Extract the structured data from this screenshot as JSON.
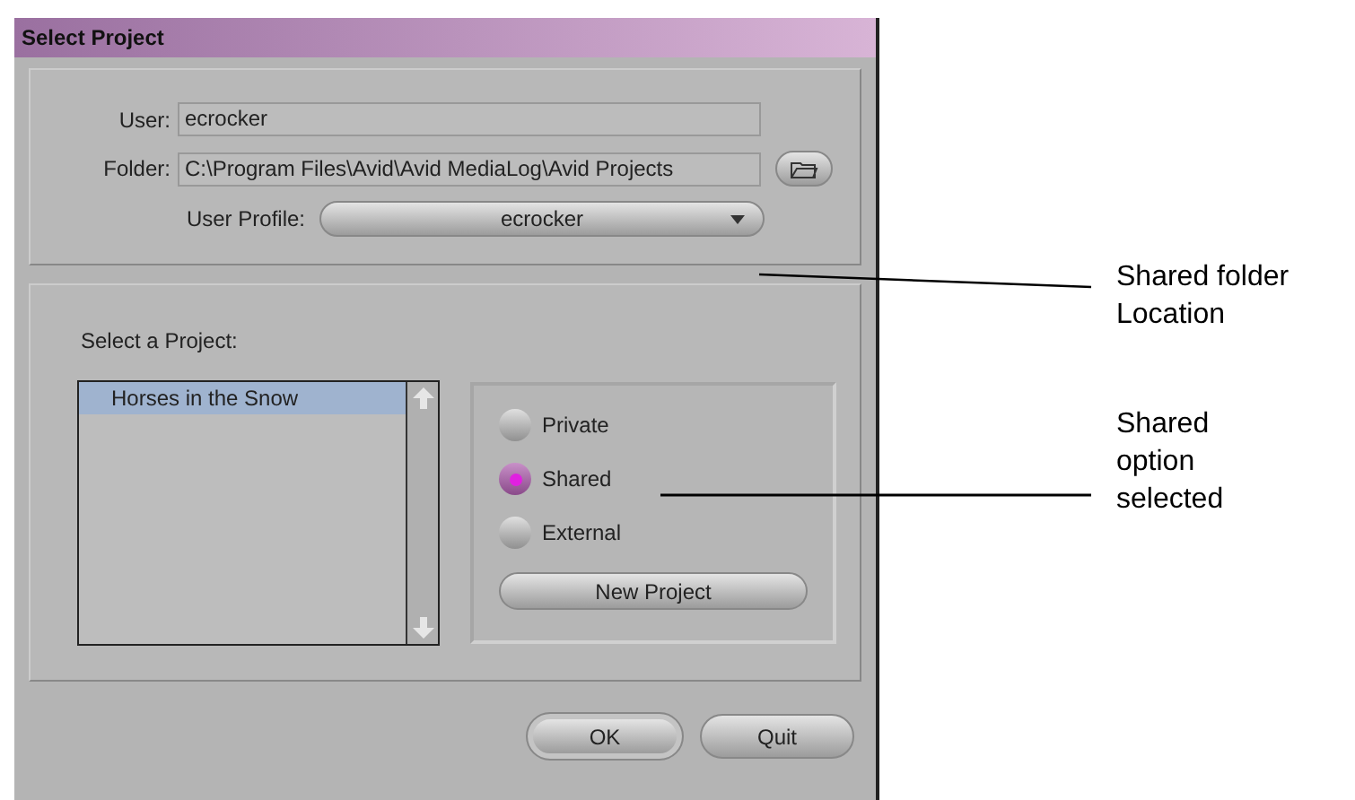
{
  "window": {
    "title": "Select Project"
  },
  "user": {
    "label": "User:",
    "value": "ecrocker"
  },
  "folder": {
    "label": "Folder:",
    "value": "C:\\Program Files\\Avid\\Avid MediaLog\\Avid Projects"
  },
  "user_profile": {
    "label": "User Profile:",
    "value": "ecrocker"
  },
  "project_list": {
    "label": "Select a Project:",
    "items": [
      {
        "text": "Horses in the Snow",
        "selected": true
      }
    ]
  },
  "project_types": [
    {
      "label": "Private",
      "selected": false
    },
    {
      "label": "Shared",
      "selected": true
    },
    {
      "label": "External",
      "selected": false
    }
  ],
  "new_project_button": "New Project",
  "buttons": [
    {
      "label": "OK",
      "default": true
    },
    {
      "label": "Quit",
      "default": false
    }
  ],
  "annotations": [
    "Shared folder Location",
    "Shared option selected"
  ]
}
